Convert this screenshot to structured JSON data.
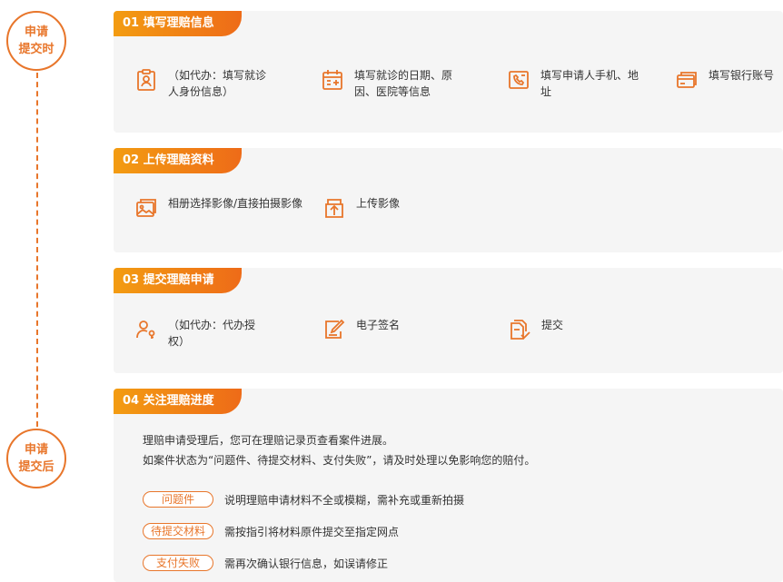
{
  "timeline": {
    "stage_before": "申请\n提交时",
    "stage_after": "申请\n提交后"
  },
  "sections": [
    {
      "title": "01 填写理赔信息",
      "steps": [
        {
          "icon": "id-badge-icon",
          "text": "（如代办：填写就诊人身份信息）"
        },
        {
          "icon": "calendar-plus-icon",
          "text": "填写就诊的日期、原因、医院等信息"
        },
        {
          "icon": "phone-card-icon",
          "text": "填写申请人手机、地址"
        },
        {
          "icon": "bank-card-icon",
          "text": "填写银行账号"
        }
      ]
    },
    {
      "title": "02 上传理赔资料",
      "steps": [
        {
          "icon": "photo-album-icon",
          "text": "相册选择影像/直接拍摄影像"
        },
        {
          "icon": "upload-icon",
          "text": "上传影像"
        }
      ]
    },
    {
      "title": "03 提交理赔申请",
      "steps": [
        {
          "icon": "user-authorize-icon",
          "text": "（如代办：代办授权）"
        },
        {
          "icon": "e-signature-icon",
          "text": "电子签名"
        },
        {
          "icon": "submit-document-icon",
          "text": "提交"
        }
      ]
    },
    {
      "title": "04 关注理赔进度",
      "description": [
        "理赔申请受理后，您可在理赔记录页查看案件进展。",
        "如案件状态为“问题件、待提交材料、支付失败”，请及时处理以免影响您的赔付。"
      ],
      "statuses": [
        {
          "label": "问题件",
          "note": "说明理赔申请材料不全或模糊，需补充或重新拍摄"
        },
        {
          "label": "待提交材料",
          "note": "需按指引将材料原件提交至指定网点"
        },
        {
          "label": "支付失败",
          "note": "需再次确认银行信息，如误请修正"
        }
      ]
    }
  ],
  "colors": {
    "accent": "#e8762b",
    "card_bg": "#f5f5f5",
    "header_gradient_start": "#f39c12",
    "header_gradient_end": "#ee6b18"
  }
}
